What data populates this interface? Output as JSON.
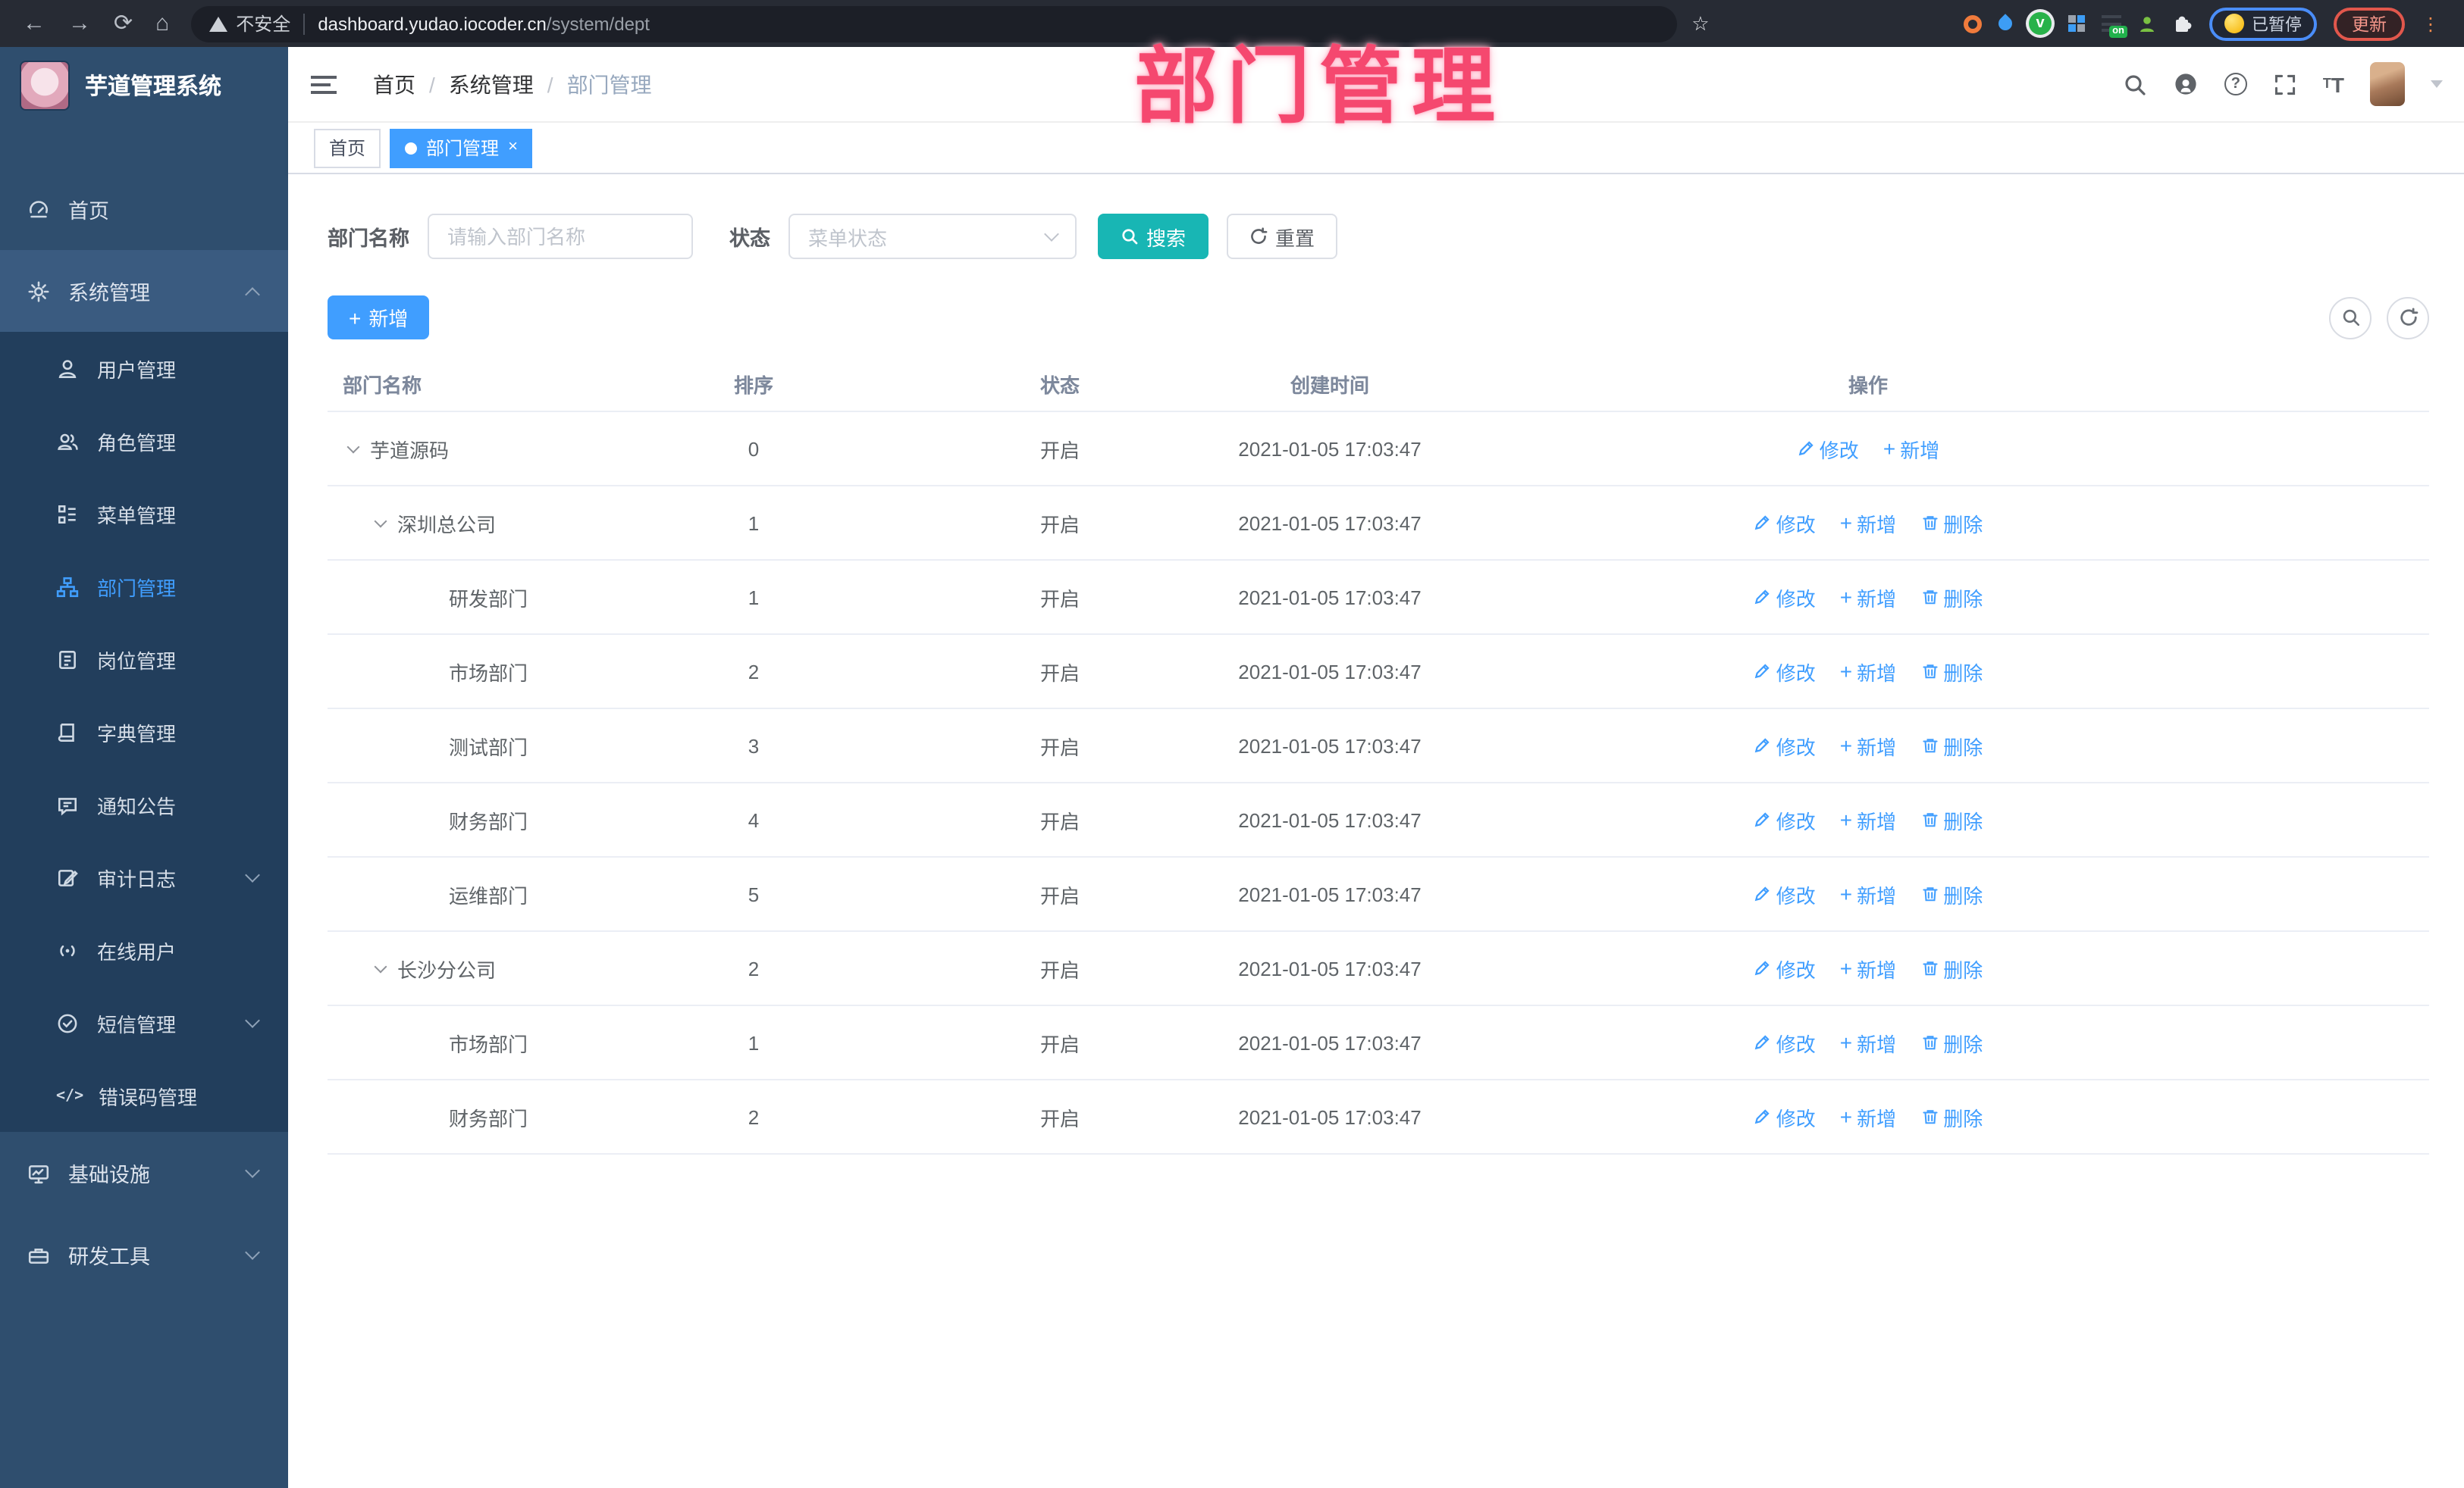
{
  "colors": {
    "accent": "#409EFF",
    "search_teal": "#18B6B4",
    "overlay_pink": "#F5486F",
    "sidebar_bg": "#2F4E6E",
    "submenu_bg": "#223E5C"
  },
  "browser": {
    "security_label": "不安全",
    "url_host": "dashboard.yudao.iocoder.cn",
    "url_path": "/system/dept",
    "extension_badge": "on",
    "paused_label": "已暂停",
    "update_label": "更新"
  },
  "overlay": {
    "title": "部门管理"
  },
  "sidebar": {
    "title": "芋道管理系统",
    "top_items": [
      {
        "label": "首页"
      },
      {
        "label": "系统管理"
      }
    ],
    "submenu": [
      {
        "label": "用户管理"
      },
      {
        "label": "角色管理"
      },
      {
        "label": "菜单管理"
      },
      {
        "label": "部门管理"
      },
      {
        "label": "岗位管理"
      },
      {
        "label": "字典管理"
      },
      {
        "label": "通知公告"
      },
      {
        "label": "审计日志"
      },
      {
        "label": "在线用户"
      },
      {
        "label": "短信管理"
      },
      {
        "label": "错误码管理"
      }
    ],
    "bottom_items": [
      {
        "label": "基础设施"
      },
      {
        "label": "研发工具"
      }
    ]
  },
  "header": {
    "breadcrumb": [
      "首页",
      "系统管理",
      "部门管理"
    ]
  },
  "tabs": [
    {
      "label": "首页"
    },
    {
      "label": "部门管理"
    }
  ],
  "filter": {
    "name_label": "部门名称",
    "name_placeholder": "请输入部门名称",
    "status_label": "状态",
    "status_placeholder": "菜单状态",
    "search_label": "搜索",
    "reset_label": "重置"
  },
  "toolbar": {
    "add_label": "新增"
  },
  "table": {
    "columns": [
      "部门名称",
      "排序",
      "状态",
      "创建时间",
      "操作"
    ],
    "action_labels": {
      "edit": "修改",
      "add": "新增",
      "delete": "删除"
    },
    "rows": [
      {
        "name": "芋道源码",
        "level": 0,
        "expandable": true,
        "sort": "0",
        "status": "开启",
        "time": "2021-01-05 17:03:47",
        "can_delete": false
      },
      {
        "name": "深圳总公司",
        "level": 1,
        "expandable": true,
        "sort": "1",
        "status": "开启",
        "time": "2021-01-05 17:03:47",
        "can_delete": true
      },
      {
        "name": "研发部门",
        "level": 2,
        "expandable": false,
        "sort": "1",
        "status": "开启",
        "time": "2021-01-05 17:03:47",
        "can_delete": true
      },
      {
        "name": "市场部门",
        "level": 2,
        "expandable": false,
        "sort": "2",
        "status": "开启",
        "time": "2021-01-05 17:03:47",
        "can_delete": true
      },
      {
        "name": "测试部门",
        "level": 2,
        "expandable": false,
        "sort": "3",
        "status": "开启",
        "time": "2021-01-05 17:03:47",
        "can_delete": true
      },
      {
        "name": "财务部门",
        "level": 2,
        "expandable": false,
        "sort": "4",
        "status": "开启",
        "time": "2021-01-05 17:03:47",
        "can_delete": true
      },
      {
        "name": "运维部门",
        "level": 2,
        "expandable": false,
        "sort": "5",
        "status": "开启",
        "time": "2021-01-05 17:03:47",
        "can_delete": true
      },
      {
        "name": "长沙分公司",
        "level": 1,
        "expandable": true,
        "sort": "2",
        "status": "开启",
        "time": "2021-01-05 17:03:47",
        "can_delete": true
      },
      {
        "name": "市场部门",
        "level": 2,
        "expandable": false,
        "sort": "1",
        "status": "开启",
        "time": "2021-01-05 17:03:47",
        "can_delete": true
      },
      {
        "name": "财务部门",
        "level": 2,
        "expandable": false,
        "sort": "2",
        "status": "开启",
        "time": "2021-01-05 17:03:47",
        "can_delete": true
      }
    ]
  }
}
